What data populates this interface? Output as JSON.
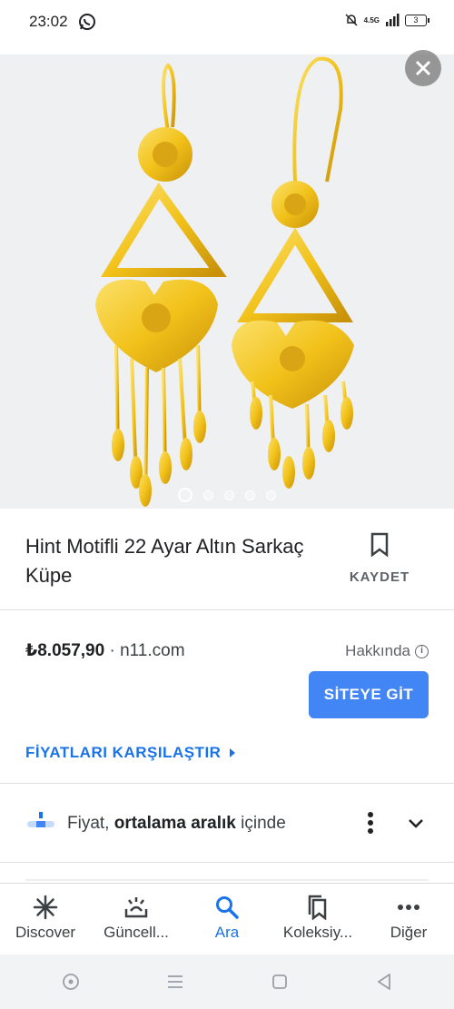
{
  "status_bar": {
    "time": "23:02",
    "network": "4.5G",
    "battery": "3"
  },
  "product_image": {
    "alt_icon": "gold-earrings-image",
    "carousel_count": 5,
    "carousel_active": 1
  },
  "product": {
    "title": "Hint Motifli 22 Ayar Altın Sarkaç Küpe",
    "save_label": "KAYDET"
  },
  "offer": {
    "price": "₺8.057,90",
    "separator": " · ",
    "merchant": "n11.com",
    "about_label": "Hakkında",
    "site_button": "SİTEYE GİT",
    "compare_prices": "FİYATLARI KARŞILAŞTIR"
  },
  "price_insight": {
    "prefix": "Fiyat, ",
    "bold": "ortalama aralık",
    "suffix": " içinde"
  },
  "bottom_nav": {
    "items": [
      {
        "label": "Discover",
        "icon": "asterisk-icon"
      },
      {
        "label": "Güncell...",
        "icon": "updates-icon"
      },
      {
        "label": "Ara",
        "icon": "search-icon"
      },
      {
        "label": "Koleksiy...",
        "icon": "collections-icon"
      },
      {
        "label": "Diğer",
        "icon": "more-horizontal-icon"
      }
    ],
    "active_index": 2
  },
  "colors": {
    "accent": "#1a73e8",
    "button": "#4285f4",
    "gold": "#f2c21a"
  }
}
